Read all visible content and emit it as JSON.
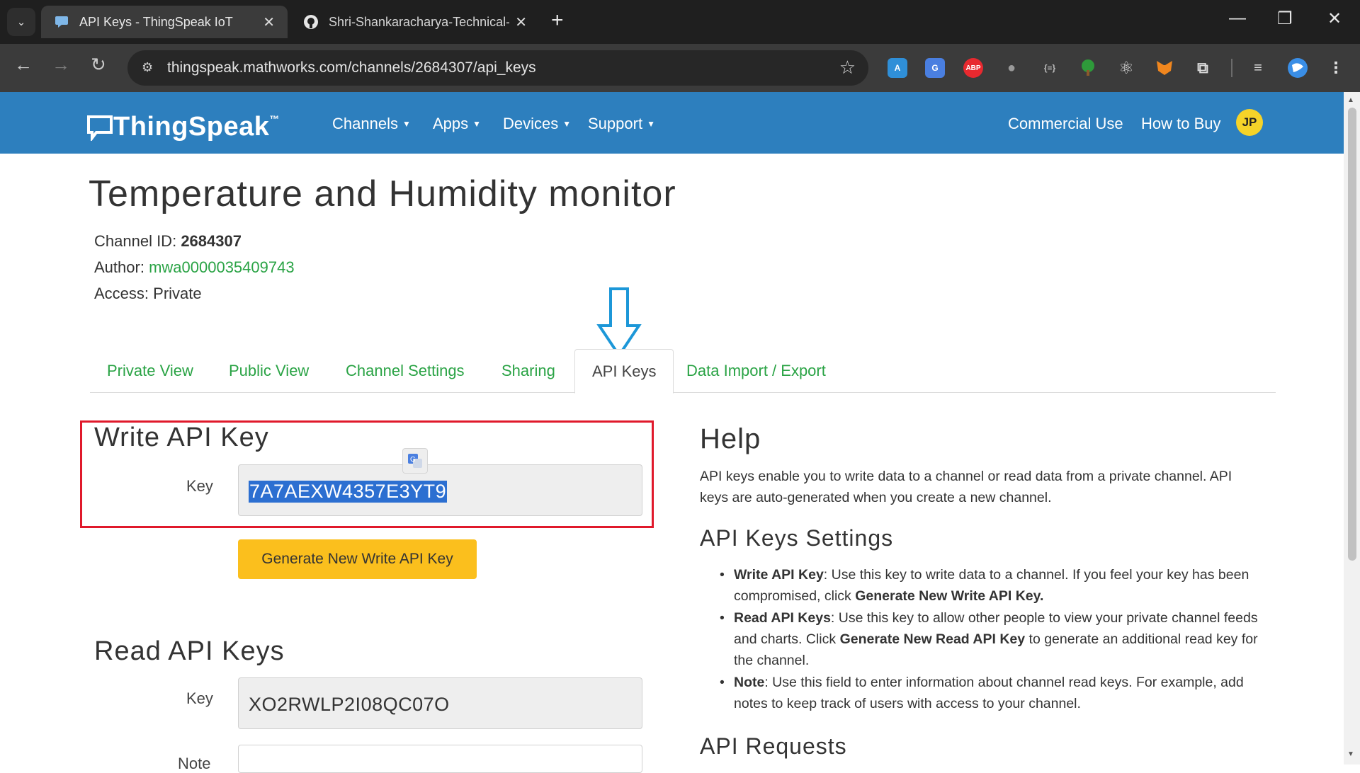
{
  "browser": {
    "tabs": [
      {
        "title": "API Keys - ThingSpeak IoT",
        "active": true
      },
      {
        "title": "Shri-Shankaracharya-Technical-",
        "active": false
      }
    ],
    "url": "thingspeak.mathworks.com/channels/2684307/api_keys",
    "extensions": [
      "translate-a-icon",
      "google-translate-icon",
      "adblock-plus-icon",
      "extension-icon",
      "json-viewer-icon",
      "tree-icon",
      "react-devtools-icon",
      "metamask-icon",
      "extensions-puzzle-icon",
      "media-control-icon",
      "profile-avatar-icon"
    ],
    "extension_labels": {
      "abp": "ABP",
      "json": "{≡}"
    }
  },
  "site": {
    "logo": "ThingSpeak",
    "logo_tm": "™",
    "nav": [
      {
        "label": "Channels",
        "dropdown": true
      },
      {
        "label": "Apps",
        "dropdown": true
      },
      {
        "label": "Devices",
        "dropdown": true
      },
      {
        "label": "Support",
        "dropdown": true
      }
    ],
    "right_links": [
      "Commercial Use",
      "How to Buy"
    ],
    "avatar_initials": "JP",
    "brand_color": "#2d7fbe"
  },
  "channel": {
    "title": "Temperature and Humidity monitor",
    "id_label": "Channel ID:",
    "id_value": "2684307",
    "author_label": "Author:",
    "author_value": "mwa0000035409743",
    "access_label": "Access:",
    "access_value": "Private"
  },
  "tabs": [
    "Private View",
    "Public View",
    "Channel Settings",
    "Sharing",
    "API Keys",
    "Data Import / Export"
  ],
  "active_tab": "API Keys",
  "write_key": {
    "heading": "Write API Key",
    "label": "Key",
    "value": "7A7AEXW4357E3YT9",
    "button": "Generate New Write API Key"
  },
  "read_key": {
    "heading": "Read API Keys",
    "label": "Key",
    "value": "XO2RWLP2I08QC07O",
    "note_label": "Note"
  },
  "help": {
    "heading": "Help",
    "intro": "API keys enable you to write data to a channel or read data from a private channel. API keys are auto-generated when you create a new channel.",
    "settings_heading": "API Keys Settings",
    "items": [
      {
        "term": "Write API Key",
        "text": ": Use this key to write data to a channel. If you feel your key has been compromised, click ",
        "bold_end": "Generate New Write API Key.",
        "tail": ""
      },
      {
        "term": "Read API Keys",
        "text": ": Use this key to allow other people to view your private channel feeds and charts. Click ",
        "bold_end": "Generate New Read API Key",
        "tail": " to generate an additional read key for the channel."
      },
      {
        "term": "Note",
        "text": ": Use this field to enter information about channel read keys. For example, add notes to keep track of users with access to your channel.",
        "bold_end": "",
        "tail": ""
      }
    ],
    "requests_heading": "API Requests"
  },
  "annotation_color": "#1c97d8",
  "highlight_color": "#e0192b"
}
